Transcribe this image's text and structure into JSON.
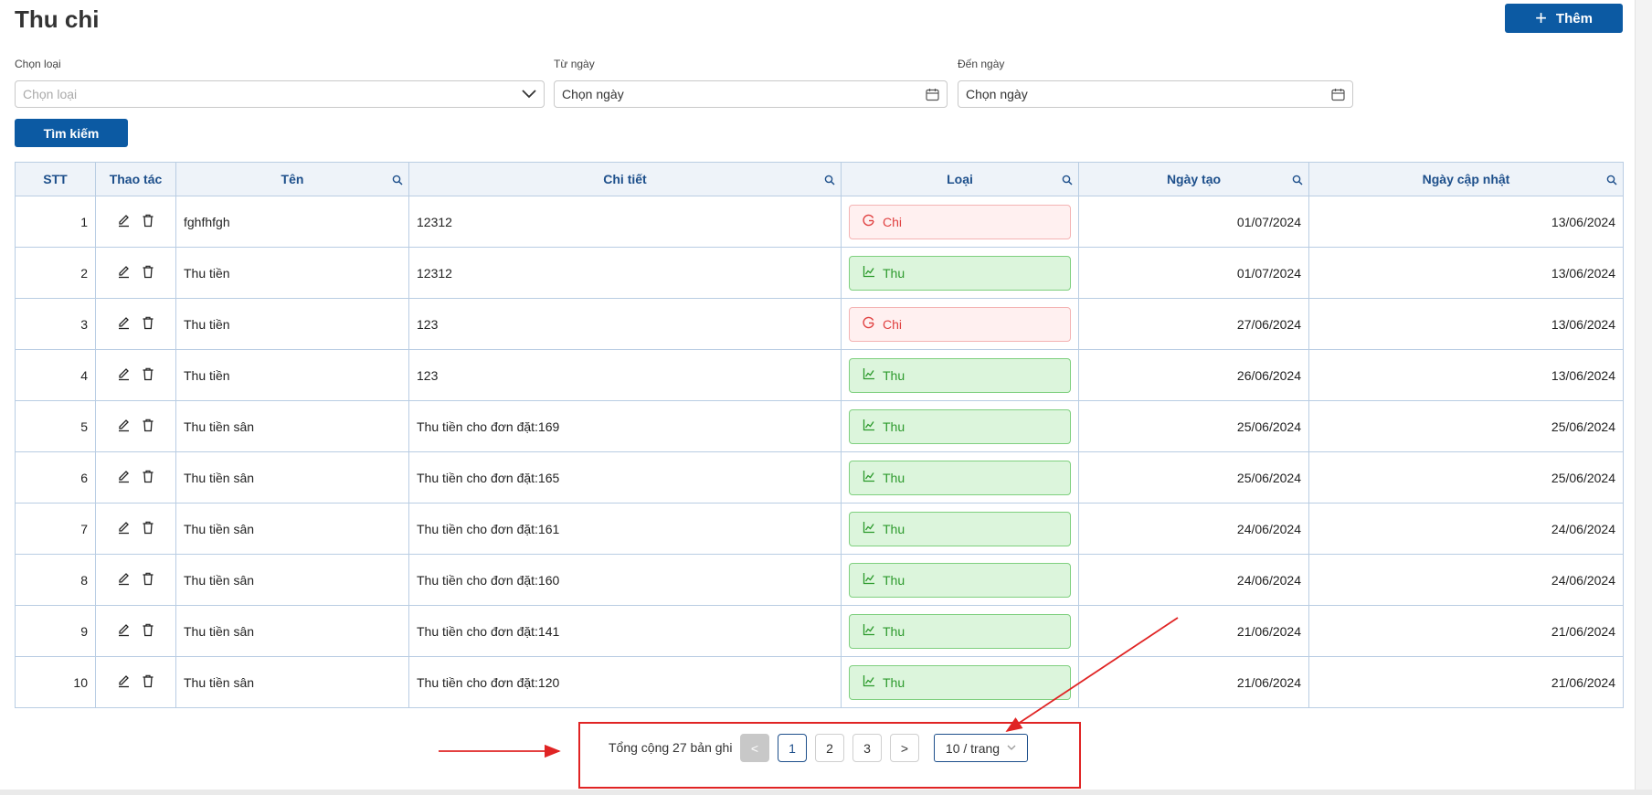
{
  "page": {
    "title": "Thu chi",
    "add_button_label": "Thêm"
  },
  "filters": {
    "type": {
      "label": "Chọn loại",
      "placeholder": "Chọn loại"
    },
    "from_date": {
      "label": "Từ ngày",
      "value": "Chọn ngày"
    },
    "to_date": {
      "label": "Đến ngày",
      "value": "Chọn ngày"
    },
    "search_button_label": "Tìm kiếm"
  },
  "table": {
    "headers": [
      "STT",
      "Thao tác",
      "Tên",
      "Chi tiết",
      "Loại",
      "Ngày tạo",
      "Ngày cập nhật"
    ],
    "rows": [
      {
        "stt": "1",
        "name": "fghfhfgh",
        "detail": "12312",
        "type": "Chi",
        "created": "01/07/2024",
        "updated": "13/06/2024"
      },
      {
        "stt": "2",
        "name": "Thu tiền",
        "detail": "12312",
        "type": "Thu",
        "created": "01/07/2024",
        "updated": "13/06/2024"
      },
      {
        "stt": "3",
        "name": "Thu tiền",
        "detail": "123",
        "type": "Chi",
        "created": "27/06/2024",
        "updated": "13/06/2024"
      },
      {
        "stt": "4",
        "name": "Thu tiền",
        "detail": "123",
        "type": "Thu",
        "created": "26/06/2024",
        "updated": "13/06/2024"
      },
      {
        "stt": "5",
        "name": "Thu tiền sân",
        "detail": "Thu tiền cho đơn đặt:169",
        "type": "Thu",
        "created": "25/06/2024",
        "updated": "25/06/2024"
      },
      {
        "stt": "6",
        "name": "Thu tiền sân",
        "detail": "Thu tiền cho đơn đặt:165",
        "type": "Thu",
        "created": "25/06/2024",
        "updated": "25/06/2024"
      },
      {
        "stt": "7",
        "name": "Thu tiền sân",
        "detail": "Thu tiền cho đơn đặt:161",
        "type": "Thu",
        "created": "24/06/2024",
        "updated": "24/06/2024"
      },
      {
        "stt": "8",
        "name": "Thu tiền sân",
        "detail": "Thu tiền cho đơn đặt:160",
        "type": "Thu",
        "created": "24/06/2024",
        "updated": "24/06/2024"
      },
      {
        "stt": "9",
        "name": "Thu tiền sân",
        "detail": "Thu tiền cho đơn đặt:141",
        "type": "Thu",
        "created": "21/06/2024",
        "updated": "21/06/2024"
      },
      {
        "stt": "10",
        "name": "Thu tiền sân",
        "detail": "Thu tiền cho đơn đặt:120",
        "type": "Thu",
        "created": "21/06/2024",
        "updated": "21/06/2024"
      }
    ]
  },
  "pagination": {
    "total_text": "Tổng cộng 27 bản ghi",
    "prev": "<",
    "pages": [
      "1",
      "2",
      "3"
    ],
    "current_page": "1",
    "next": ">",
    "page_size": "10 / trang"
  },
  "icons": {
    "add": "plus-icon",
    "dropdown": "chevron-down-icon",
    "calendar": "calendar-icon",
    "column_search": "search-icon",
    "edit": "edit-icon",
    "delete": "trash-icon",
    "chi": "power-icon",
    "thu": "chart-line-icon"
  },
  "colors": {
    "primary": "#0c5aa3",
    "header_text": "#1d4f8b",
    "chi": "#e04040",
    "thu": "#2c9a2c",
    "annotation": "#e02424"
  }
}
